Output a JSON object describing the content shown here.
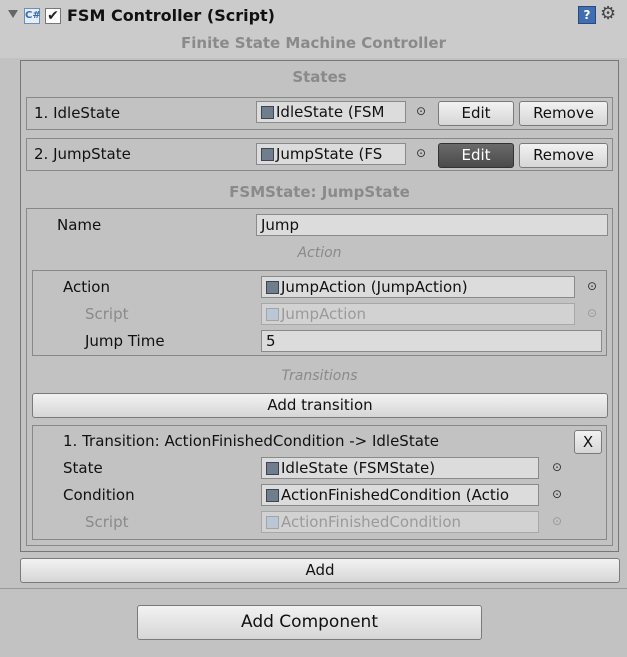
{
  "component": {
    "title": "FSM Controller (Script)",
    "subtitle": "Finite State Machine Controller",
    "enabled": true,
    "script_icon_glyph": "C#",
    "icons": [
      "foldout-arrow-icon",
      "csharp-script-icon",
      "help-icon",
      "gear-icon"
    ]
  },
  "states_section": {
    "header": "States",
    "items": [
      {
        "label": "1. IdleState",
        "value": "IdleState (FSM",
        "edit": "Edit",
        "remove": "Remove",
        "active": false
      },
      {
        "label": "2. JumpState",
        "value": "JumpState (FS",
        "edit": "Edit",
        "remove": "Remove",
        "active": true
      }
    ]
  },
  "state_detail": {
    "header": "FSMState: JumpState",
    "name_label": "Name",
    "name_value": "Jump",
    "action_header": "Action",
    "action": {
      "action_label": "Action",
      "action_value": "JumpAction (JumpAction)",
      "script_label": "Script",
      "script_value": "JumpAction",
      "jump_time_label": "Jump Time",
      "jump_time_value": "5"
    },
    "transitions_header": "Transitions",
    "add_transition": "Add transition",
    "transition": {
      "title": "1. Transition: ActionFinishedCondition -> IdleState",
      "close": "X",
      "state_label": "State",
      "state_value": "IdleState (FSMState)",
      "condition_label": "Condition",
      "condition_value": "ActionFinishedCondition (Actio",
      "script_label": "Script",
      "script_value": "ActionFinishedCondition"
    }
  },
  "add_button": "Add",
  "add_component_button": "Add Component",
  "object_picker_glyph": "⊙",
  "colors": {
    "panel_bg": "#c2c2c2",
    "active_button": "#555555",
    "help_icon": "#3f6fb2"
  }
}
